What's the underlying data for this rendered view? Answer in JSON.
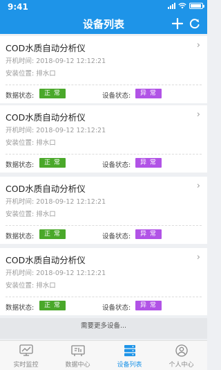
{
  "status_bar": {
    "time": "9:41"
  },
  "header": {
    "title": "设备列表",
    "add_icon": "plus-icon",
    "refresh_icon": "refresh-icon",
    "background": "#1e94e8"
  },
  "devices": [
    {
      "name": "COD水质自动分析仪",
      "boot_time": "开机时间:  2018-09-12 12:12:21",
      "location": "安装位置:  排水口",
      "data_status_label": "数据状态:",
      "data_status": "正 常",
      "device_status_label": "设备状态:",
      "device_status": "异 常"
    },
    {
      "name": "COD水质自动分析仪",
      "boot_time": "开机时间:  2018-09-12 12:12:21",
      "location": "安装位置:  排水口",
      "data_status_label": "数据状态:",
      "data_status": "正 常",
      "device_status_label": "设备状态:",
      "device_status": "异 常"
    },
    {
      "name": "COD水质自动分析仪",
      "boot_time": "开机时间:  2018-09-12 12:12:21",
      "location": "安装位置:  排水口",
      "data_status_label": "数据状态:",
      "data_status": "正 常",
      "device_status_label": "设备状态:",
      "device_status": "异 常"
    },
    {
      "name": "COD水质自动分析仪",
      "boot_time": "开机时间:  2018-09-12 12:12:21",
      "location": "安装位置:  排水口",
      "data_status_label": "数据状态:",
      "data_status": "正 常",
      "device_status_label": "设备状态:",
      "device_status": "异 常"
    }
  ],
  "status_colors": {
    "normal": "#4aa82a",
    "abnormal": "#b153e6"
  },
  "more_text": "需要更多设备...",
  "tabs": [
    {
      "label": "实时监控",
      "icon": "monitor-chart-icon",
      "active": false
    },
    {
      "label": "数据中心",
      "icon": "data-center-icon",
      "active": false
    },
    {
      "label": "设备列表",
      "icon": "server-list-icon",
      "active": true
    },
    {
      "label": "个人中心",
      "icon": "person-icon",
      "active": false
    }
  ]
}
